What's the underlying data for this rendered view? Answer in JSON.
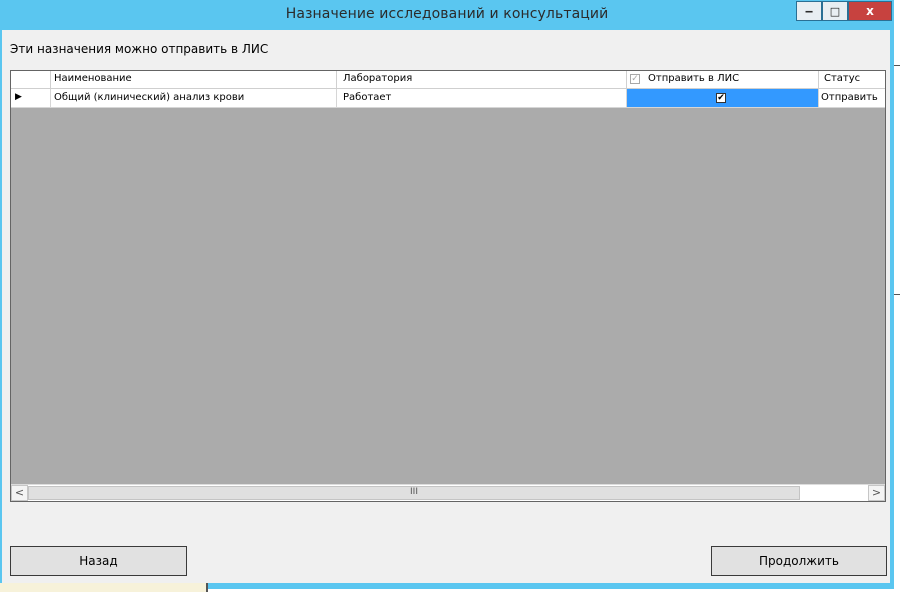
{
  "window": {
    "title": "Назначение исследований и консультаций",
    "controls": {
      "minimize": "‒",
      "maximize": "□",
      "close": "x"
    }
  },
  "hint_text": "Эти назначения можно отправить в ЛИС",
  "grid": {
    "columns": [
      "Наименование",
      "Лаборатория",
      "Отправить в ЛИС",
      "Статус"
    ],
    "header_checkbox": "✓",
    "rows": [
      {
        "indicator": "▶",
        "name": "Общий (клинический) анализ крови",
        "laboratory": "Работает",
        "send_to_lis": "✔",
        "status": "Отправить"
      }
    ],
    "scroll": {
      "left": "<",
      "right": ">",
      "thumb": "III"
    }
  },
  "buttons": {
    "back": "Назад",
    "continue": "Продолжить"
  }
}
